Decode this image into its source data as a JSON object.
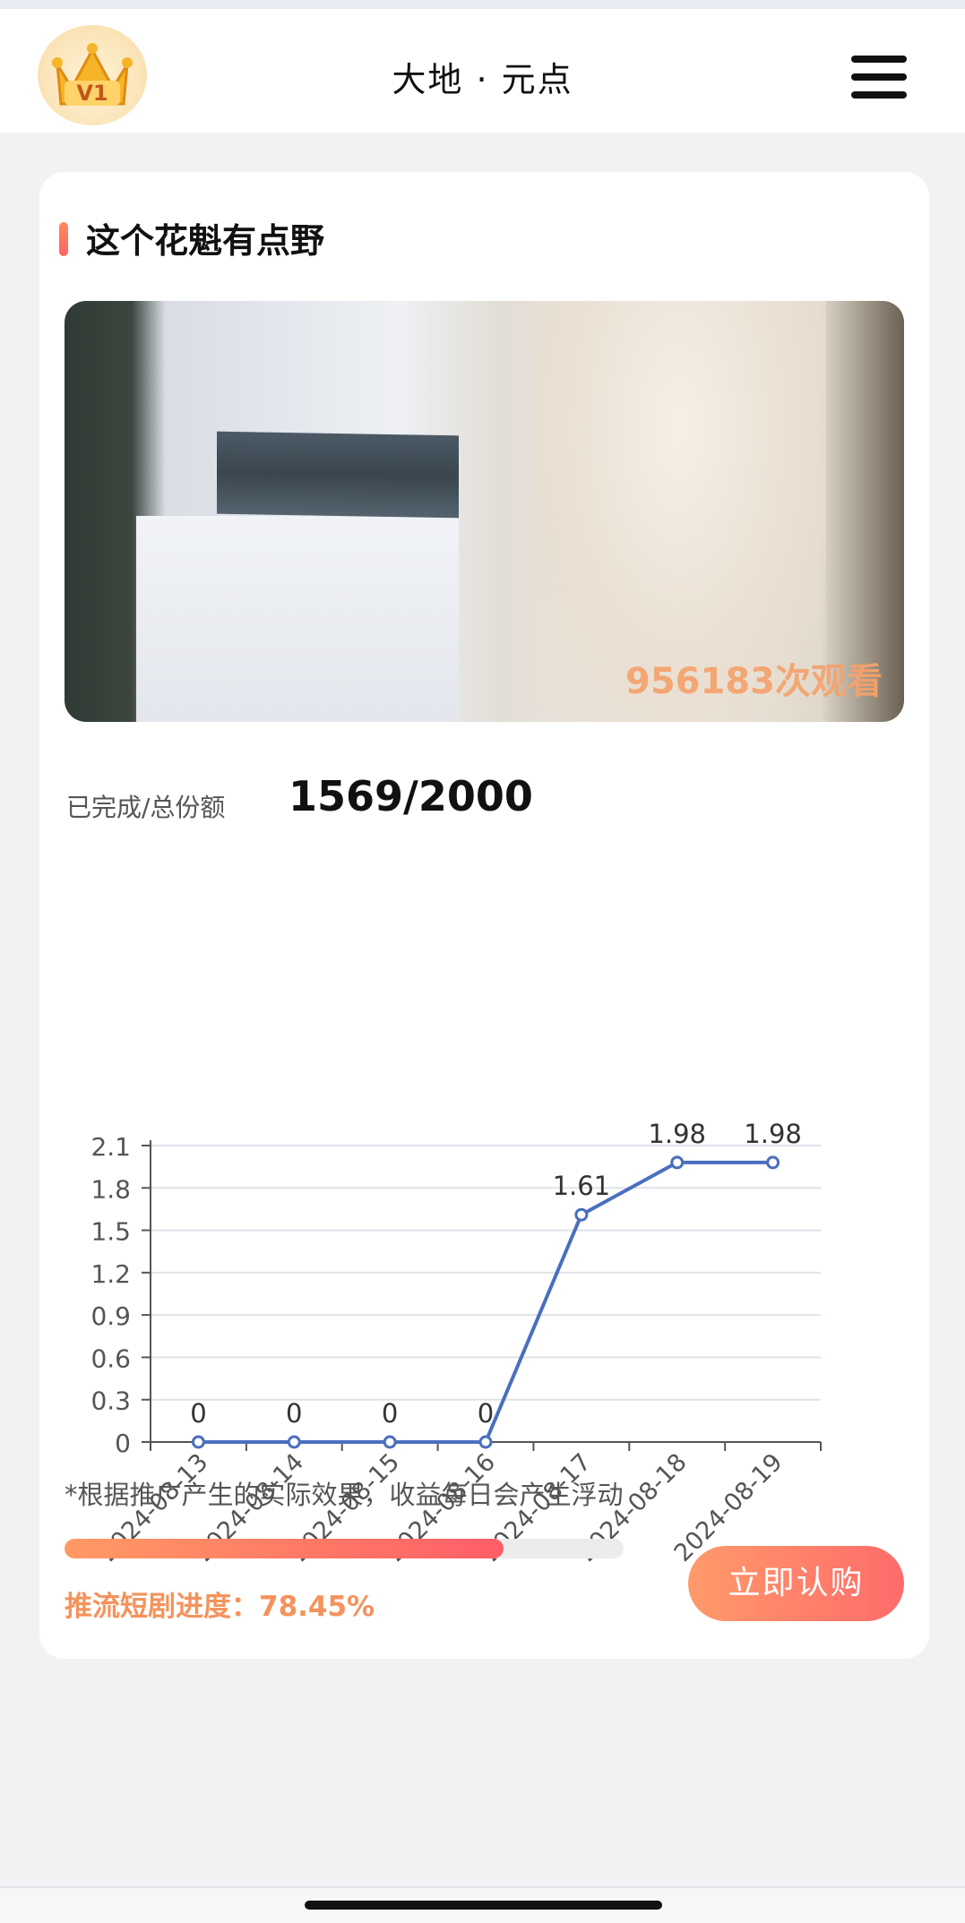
{
  "header": {
    "title": "大地 · 元点",
    "badge_text": "V1",
    "menu_icon": "hamburger-menu-icon"
  },
  "card": {
    "title": "这个花魁有点野",
    "views_text": "956183次观看",
    "progress_label": "已完成/总份额",
    "progress_value": "1569/2000"
  },
  "chart_data": {
    "type": "line",
    "x": [
      "2024-08-13",
      "2024-08-14",
      "2024-08-15",
      "2024-08-16",
      "2024-08-17",
      "2024-08-18",
      "2024-08-19"
    ],
    "series": [
      {
        "values": [
          0,
          0,
          0,
          0,
          1.61,
          1.98,
          1.98
        ]
      }
    ],
    "y_ticks": [
      "0",
      "0.3",
      "0.6",
      "0.9",
      "1.2",
      "1.5",
      "1.8",
      "2.1"
    ],
    "ylim": [
      0,
      2.1
    ],
    "grid": true,
    "data_labels": true,
    "colors": {
      "line": "#4a6fbf",
      "grid": "#dfe3ea",
      "axis": "#555555"
    }
  },
  "footer": {
    "note": "*根据推广产生的实际效果，收益每日会产生浮动",
    "progress_fraction": 0.7845,
    "progress_text": "推流短剧进度：78.45%",
    "buy_label": "立即认购"
  },
  "colors": {
    "accent_orange": "#f4935c",
    "button_gradient_start": "#ff9a6a",
    "button_gradient_end": "#ff6b6b"
  }
}
